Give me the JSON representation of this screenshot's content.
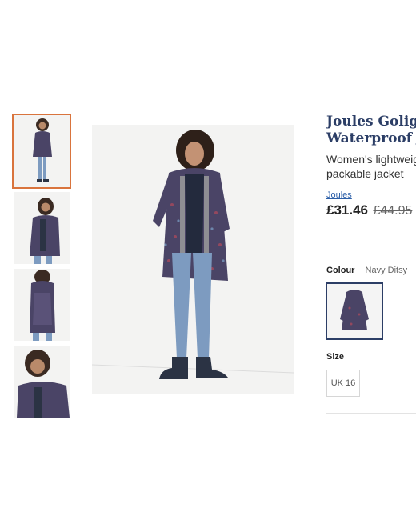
{
  "product": {
    "title_line1": "Joules Goligh",
    "title_line2": "Waterproof J",
    "subtitle_line1": "Women's lightweig",
    "subtitle_line2": "packable jacket",
    "brand": "Joules",
    "price_now": "£31.46",
    "price_was": "£44.95"
  },
  "colour": {
    "label": "Colour",
    "value": "Navy Ditsy"
  },
  "size": {
    "label": "Size",
    "option": "UK 16"
  },
  "gallery": {
    "thumbnail_count": 4,
    "selected_index": 0
  },
  "colors": {
    "accent": "#d9743d",
    "title": "#2c3e66",
    "link": "#2c5fa8",
    "jacket": "#4a4466"
  }
}
